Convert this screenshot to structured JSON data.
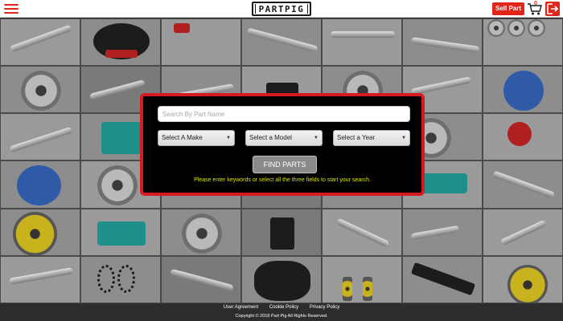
{
  "header": {
    "logo_text": "PARTPIG",
    "sell_label": "Sell Part",
    "cart_count": "0"
  },
  "search": {
    "placeholder": "Search By Part Name",
    "make_label": "Select A Make",
    "model_label": "Select a Model",
    "year_label": "Select a Year",
    "find_label": "FIND PARTS",
    "hint": "Please enter keywords or select all the three fields to start your search."
  },
  "footer": {
    "links": [
      "User Agreement",
      "Cookie Policy",
      "Privacy Policy"
    ],
    "copyright": "Copyright © 2018 Part Pig All Rights Reserved."
  },
  "colors": {
    "brand_red": "#e1251b",
    "panel_border": "#d71920",
    "hint_text": "#d8e600"
  }
}
